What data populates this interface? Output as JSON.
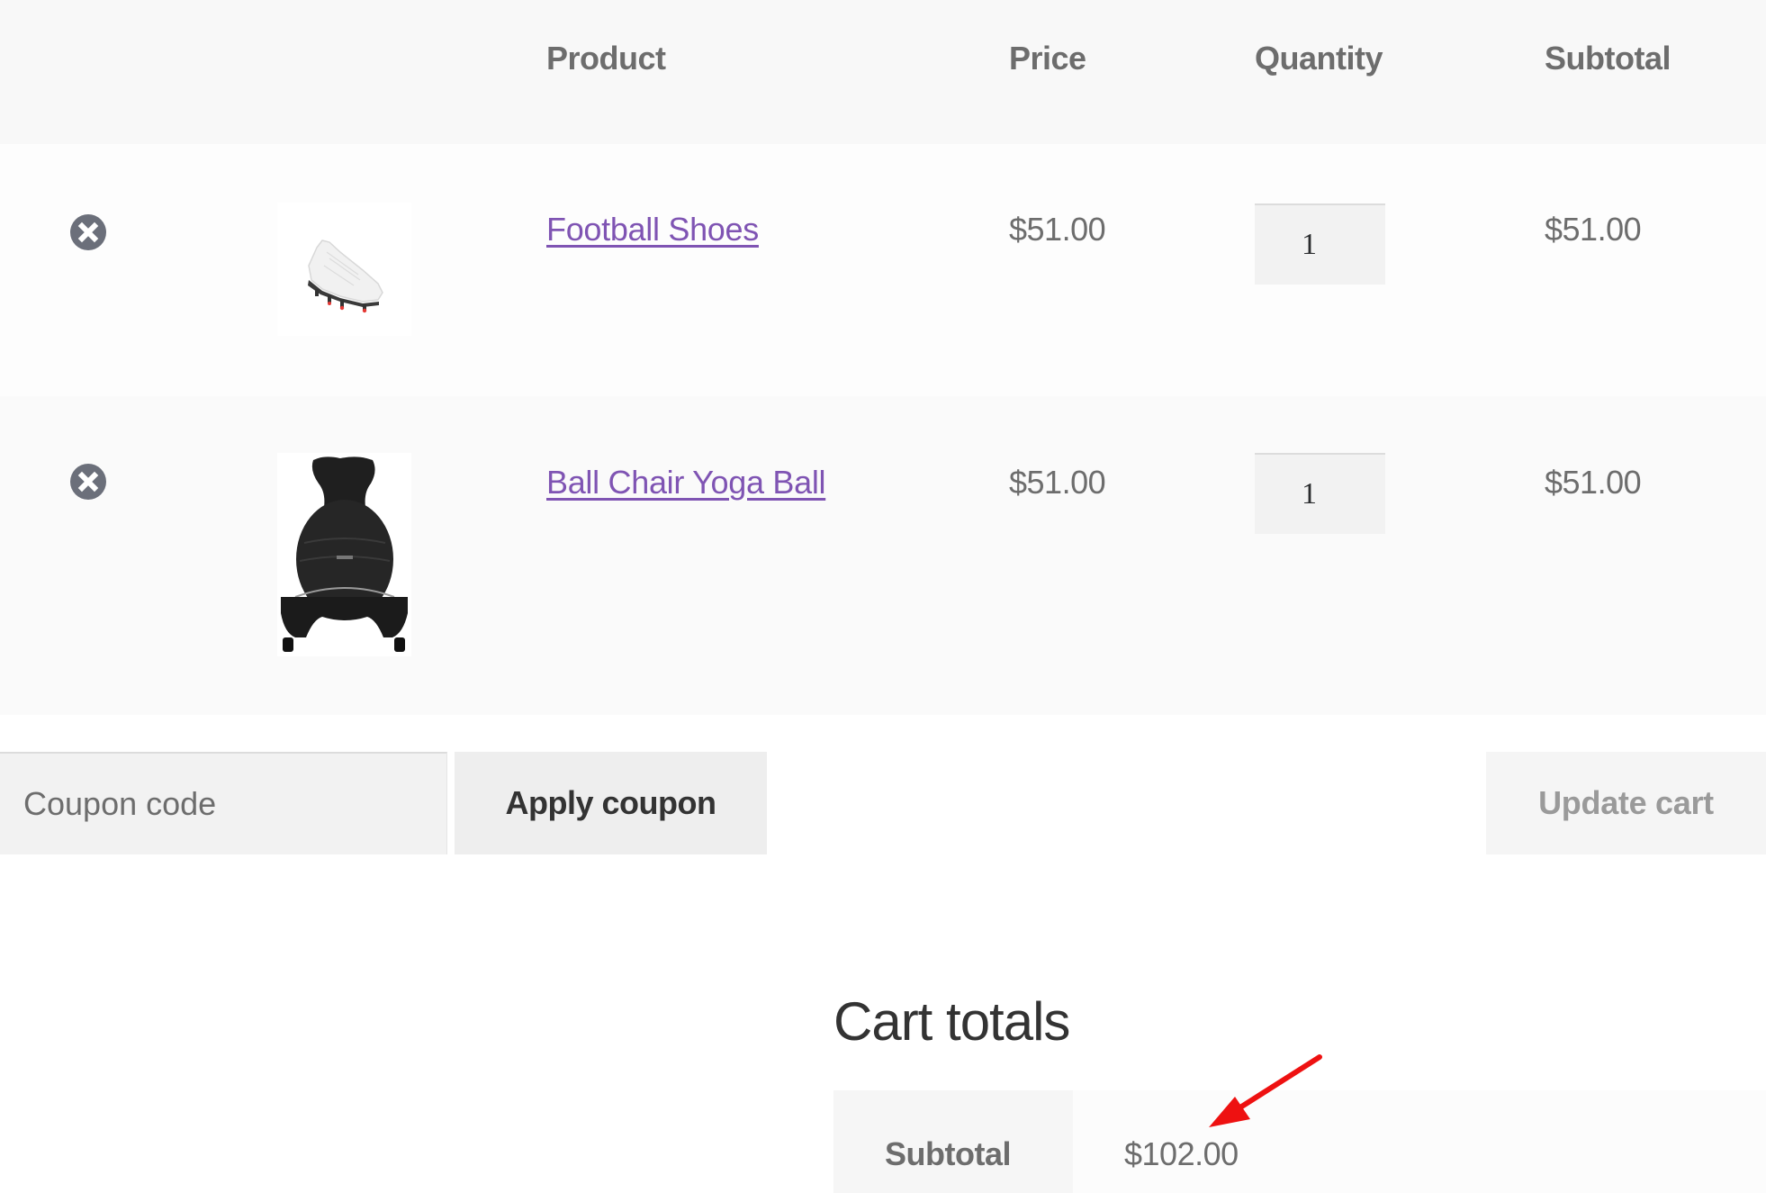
{
  "table": {
    "headers": {
      "product": "Product",
      "price": "Price",
      "quantity": "Quantity",
      "subtotal": "Subtotal"
    },
    "rows": [
      {
        "remove_icon": "remove-circle-x-icon",
        "thumbnail": "white football shoe",
        "product_name": "Football Shoes",
        "price": "$51.00",
        "quantity": "1",
        "subtotal": "$51.00"
      },
      {
        "remove_icon": "remove-circle-x-icon",
        "thumbnail": "black ball chair",
        "product_name": "Ball Chair Yoga Ball",
        "price": "$51.00",
        "quantity": "1",
        "subtotal": "$51.00"
      }
    ]
  },
  "actions": {
    "coupon_placeholder": "Coupon code",
    "coupon_value": "",
    "apply_coupon_label": "Apply coupon",
    "update_cart_label": "Update cart"
  },
  "totals": {
    "title": "Cart totals",
    "subtotal_label": "Subtotal",
    "subtotal_value": "$102.00"
  },
  "annotation": {
    "type": "red-arrow",
    "color": "#ee1111",
    "points_to": "subtotal_value"
  },
  "colors": {
    "link": "#7f54b3",
    "header_bg": "#f8f8f8",
    "remove_icon": "#6b6f7a"
  }
}
